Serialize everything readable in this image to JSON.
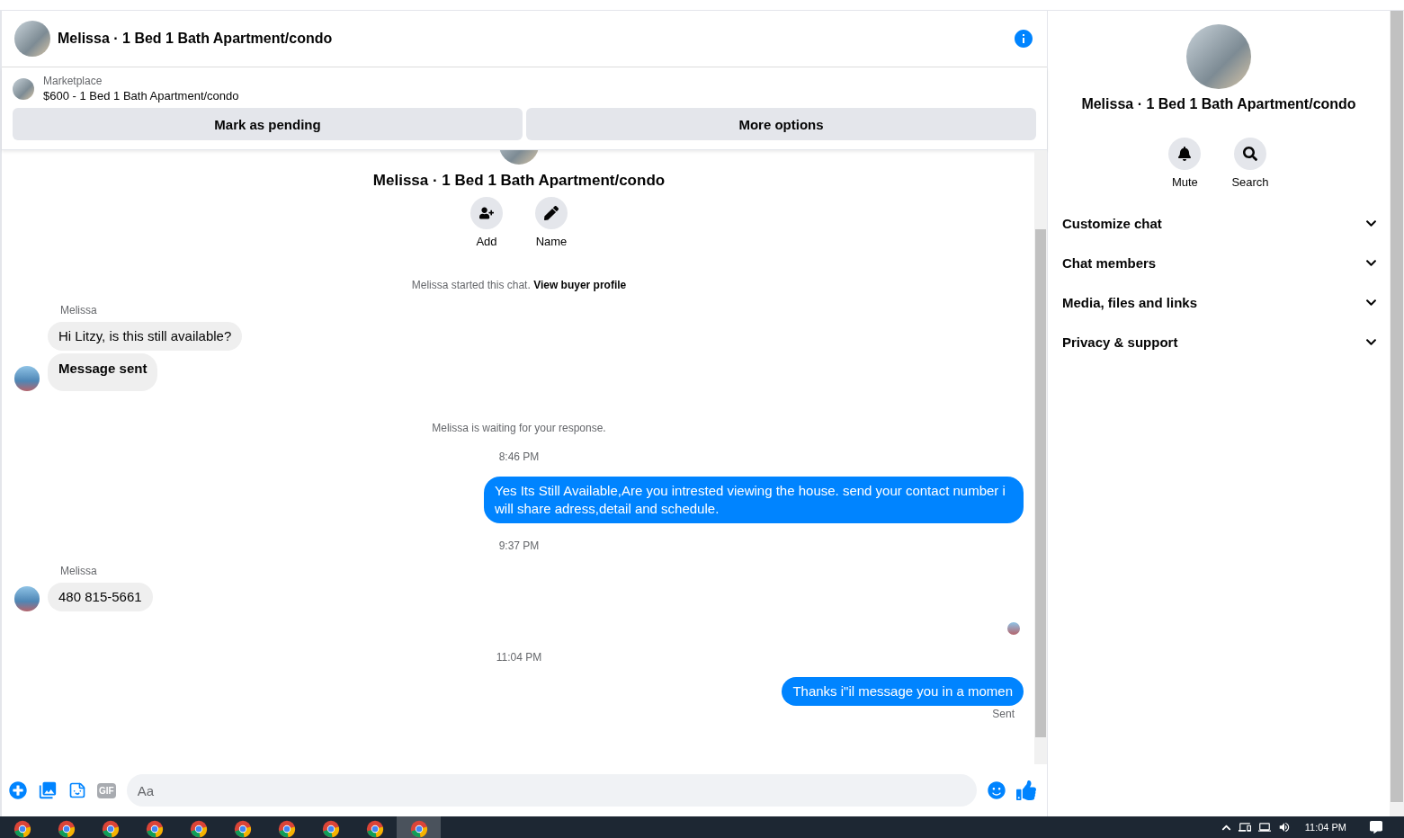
{
  "chat_header": {
    "title": "Melissa · 1 Bed 1 Bath Apartment/condo"
  },
  "listing": {
    "source": "Marketplace",
    "title": "$600 - 1 Bed 1 Bath Apartment/condo",
    "actions": [
      "Mark as pending",
      "More options"
    ]
  },
  "conversation": [
    {
      "kind": "intro",
      "title": "Melissa · 1 Bed 1 Bath Apartment/condo",
      "actions": [
        {
          "label": "Add"
        },
        {
          "label": "Name"
        }
      ]
    },
    {
      "kind": "notice",
      "text": "Melissa started this chat.",
      "link": "View buyer profile"
    },
    {
      "kind": "received",
      "sender": "Melissa",
      "bubbles": [
        {
          "text": "Hi Litzy, is this still available?",
          "bold": false
        },
        {
          "text": "Message sent",
          "bold": true
        }
      ]
    },
    {
      "kind": "notice",
      "text": "Melissa is waiting for your response."
    },
    {
      "kind": "time",
      "text": "8:46 PM"
    },
    {
      "kind": "sent",
      "text": "Yes Its Still Available,Are you intrested viewing the house. send your contact number i will share adress,detail and schedule."
    },
    {
      "kind": "time",
      "text": "9:37 PM"
    },
    {
      "kind": "received",
      "sender": "Melissa",
      "bubbles": [
        {
          "text": "480 815-5661",
          "bold": false
        }
      ]
    },
    {
      "kind": "seen"
    },
    {
      "kind": "time",
      "text": "11:04 PM"
    },
    {
      "kind": "sent",
      "text": "Thanks i\"il message you in a momen",
      "status": "Sent"
    }
  ],
  "composer": {
    "placeholder": "Aa",
    "gif_label": "GIF"
  },
  "details": {
    "title": "Melissa · 1 Bed 1 Bath Apartment/condo",
    "actions": [
      {
        "label": "Mute"
      },
      {
        "label": "Search"
      }
    ],
    "sections": [
      {
        "label": "Customize chat",
        "expanded": false
      },
      {
        "label": "Chat members",
        "expanded": false
      },
      {
        "label": "Media, files and links",
        "expanded": false
      },
      {
        "label": "Privacy & support",
        "expanded": false
      }
    ]
  },
  "taskbar": {
    "apps": [
      {
        "selected": false
      },
      {
        "selected": false
      },
      {
        "selected": false
      },
      {
        "selected": false
      },
      {
        "selected": false
      },
      {
        "selected": false
      },
      {
        "selected": false
      },
      {
        "selected": false
      },
      {
        "selected": false
      },
      {
        "selected": true
      }
    ],
    "clock": "11:04 PM"
  }
}
